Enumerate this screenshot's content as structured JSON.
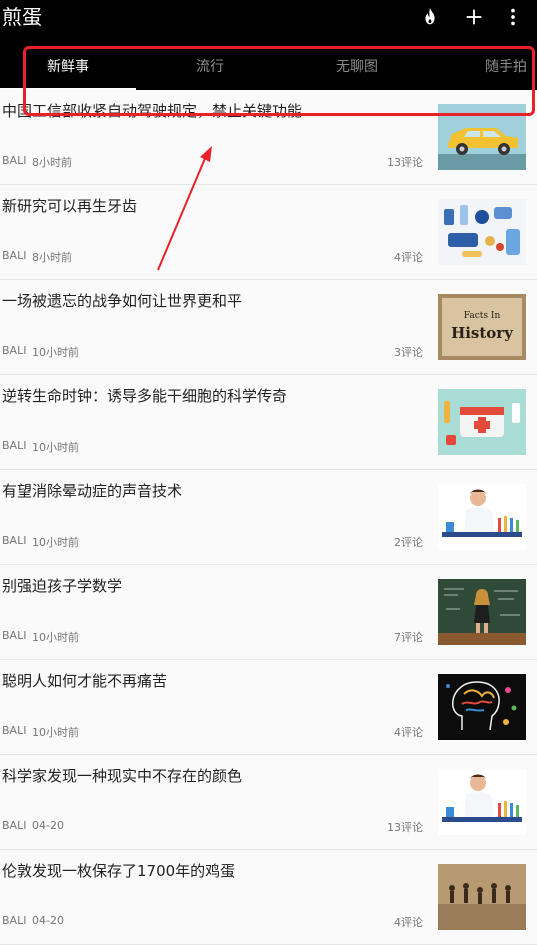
{
  "app": {
    "title": "煎蛋",
    "actions": [
      {
        "icon": "fire-icon"
      },
      {
        "icon": "plus-icon"
      },
      {
        "icon": "more-vertical-icon"
      }
    ]
  },
  "tabs": [
    {
      "label": "新鲜事",
      "active": true
    },
    {
      "label": "流行",
      "active": false
    },
    {
      "label": "无聊图",
      "active": false
    },
    {
      "label": "随手拍",
      "active": false
    }
  ],
  "colors": {
    "topbar": "#000000",
    "highlight": "#e8212a",
    "background": "#fafafa"
  },
  "articles": [
    {
      "title": "中国工信部收紧自动驾驶规定，禁止关键功能",
      "author": "BALI",
      "time": "8小时前",
      "comments": "13评论",
      "thumbnail": "yellow-car"
    },
    {
      "title": "新研究可以再生牙齿",
      "author": "BALI",
      "time": "8小时前",
      "comments": "4评论",
      "thumbnail": "medical-items"
    },
    {
      "title": "一场被遗忘的战争如何让世界更和平",
      "author": "BALI",
      "time": "10小时前",
      "comments": "3评论",
      "thumbnail": "facts-in-history",
      "thumbnail_text": [
        "Facts In",
        "History"
      ]
    },
    {
      "title": "逆转生命时钟：诱导多能干细胞的科学传奇",
      "author": "BALI",
      "time": "10小时前",
      "comments": "",
      "thumbnail": "first-aid-kit"
    },
    {
      "title": "有望消除晕动症的声音技术",
      "author": "BALI",
      "time": "10小时前",
      "comments": "2评论",
      "thumbnail": "scientist-lab"
    },
    {
      "title": "别强迫孩子学数学",
      "author": "BALI",
      "time": "10小时前",
      "comments": "7评论",
      "thumbnail": "chalkboard-teacher"
    },
    {
      "title": "聪明人如何才能不再痛苦",
      "author": "BALI",
      "time": "10小时前",
      "comments": "4评论",
      "thumbnail": "colorful-brain"
    },
    {
      "title": "科学家发现一种现实中不存在的颜色",
      "author": "BALI",
      "time": "04-20",
      "comments": "13评论",
      "thumbnail": "scientist-lab"
    },
    {
      "title": "伦敦发现一枚保存了1700年的鸡蛋",
      "author": "BALI",
      "time": "04-20",
      "comments": "4评论",
      "thumbnail": "cave-painting"
    }
  ]
}
